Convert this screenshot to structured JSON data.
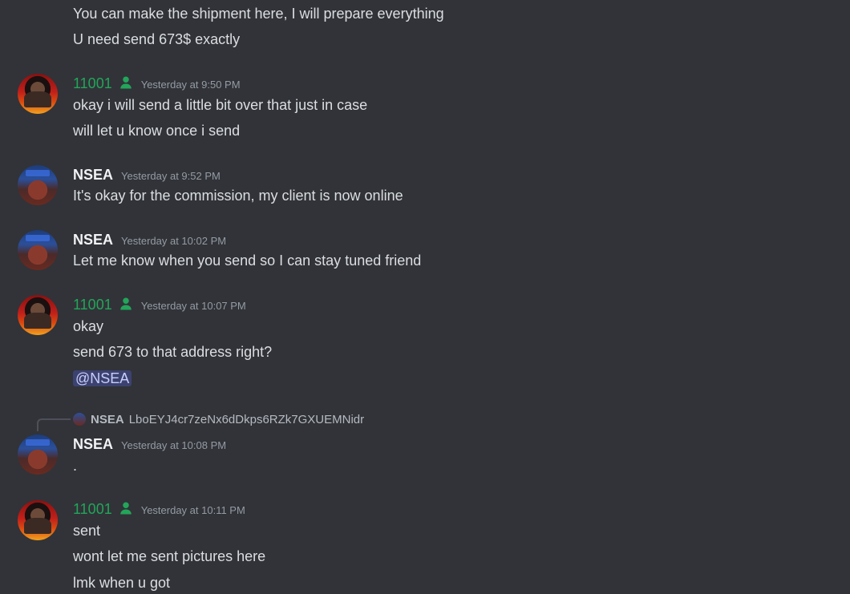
{
  "messages": [
    {
      "author": null,
      "lines": [
        "You can make the shipment here, I will prepare everything",
        "U need send 673$ exactly"
      ]
    },
    {
      "author": "11001",
      "timestamp": "Yesterday at 9:50 PM",
      "lines": [
        "okay i will send a little bit over that just in case",
        "will let u know once i send"
      ]
    },
    {
      "author": "NSEA",
      "timestamp": "Yesterday at 9:52 PM",
      "lines": [
        "It's okay for the commission, my client is now online"
      ]
    },
    {
      "author": "NSEA",
      "timestamp": "Yesterday at 10:02 PM",
      "lines": [
        "Let me know when you send so I can stay tuned friend"
      ]
    },
    {
      "author": "11001",
      "timestamp": "Yesterday at 10:07 PM",
      "lines": [
        "okay",
        "send 673 to that address right?"
      ],
      "mention": "@NSEA"
    },
    {
      "author": "NSEA",
      "timestamp": "Yesterday at 10:08 PM",
      "reply": {
        "author": "NSEA",
        "text": "LboEYJ4cr7zeNx6dDkps6RZk7GXUEMNidr"
      },
      "lines": [
        "."
      ]
    },
    {
      "author": "11001",
      "timestamp": "Yesterday at 10:11 PM",
      "lines": [
        "sent",
        "wont let me sent pictures here",
        "lmk when u got"
      ]
    }
  ],
  "colors": {
    "background": "#313338",
    "green_name": "#23a55a",
    "mention_bg": "#3c4270"
  },
  "icons": {
    "member": "person-icon"
  }
}
